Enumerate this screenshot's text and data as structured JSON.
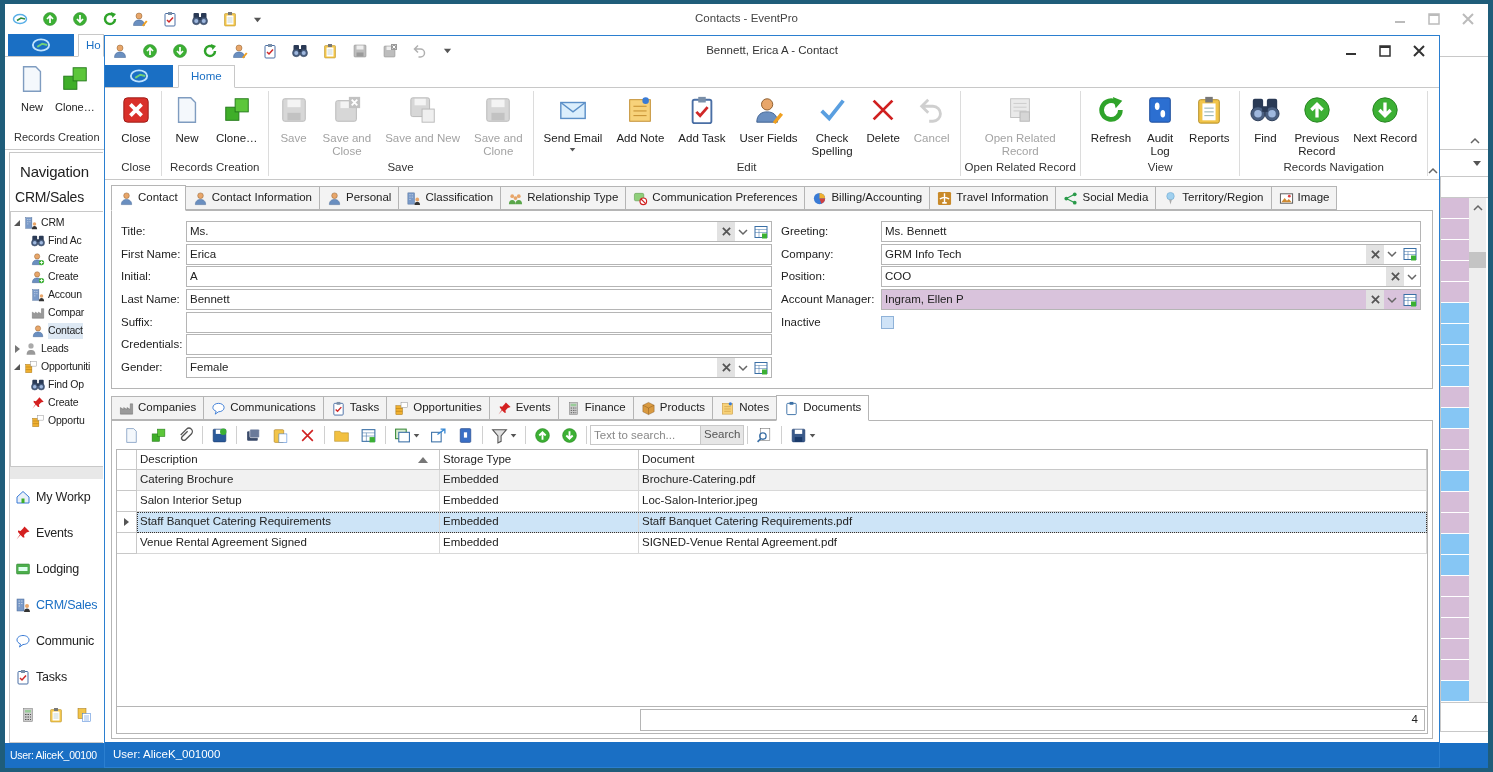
{
  "outer_window": {
    "title": "Contacts - EventPro",
    "ribbon_tabs": [
      {
        "label": "Ho",
        "selected": true
      }
    ],
    "ribbon_groups": [
      {
        "label": "Records Creation",
        "buttons": [
          {
            "label": "New",
            "disabled": false
          },
          {
            "label": "Clone…",
            "disabled": false
          }
        ]
      }
    ],
    "navigation": {
      "title": "Navigation",
      "section": "CRM/Sales",
      "tree": [
        {
          "label": "CRM",
          "expanded": true,
          "selected": false,
          "children": [
            {
              "label": "Find Ac",
              "selected": false
            },
            {
              "label": "Create",
              "selected": false
            },
            {
              "label": "Create",
              "selected": false
            },
            {
              "label": "Accoun",
              "selected": false
            },
            {
              "label": "Compar",
              "selected": false
            },
            {
              "label": "Contact",
              "selected": true
            }
          ]
        },
        {
          "label": "Leads",
          "expanded": false,
          "selected": false
        },
        {
          "label": "Opportuniti",
          "expanded": true,
          "selected": false,
          "children": [
            {
              "label": "Find Op",
              "selected": false
            },
            {
              "label": "Create",
              "selected": false
            },
            {
              "label": "Opportu",
              "selected": false
            }
          ]
        }
      ],
      "buttons": [
        {
          "label": "My Workp",
          "selected": false
        },
        {
          "label": "Events",
          "selected": false
        },
        {
          "label": "Lodging",
          "selected": false
        },
        {
          "label": "CRM/Sales",
          "selected": true
        },
        {
          "label": "Communic",
          "selected": false
        },
        {
          "label": "Tasks",
          "selected": false
        }
      ]
    },
    "grid_rows": [
      {
        "color": "#d6bdd8"
      },
      {
        "color": "#d6bdd8"
      },
      {
        "color": "#d6bdd8"
      },
      {
        "color": "#d6bdd8"
      },
      {
        "color": "#d6bdd8"
      },
      {
        "color": "#86c6f4"
      },
      {
        "color": "#86c6f4"
      },
      {
        "color": "#86c6f4"
      },
      {
        "color": "#86c6f4"
      },
      {
        "color": "#d6bdd8"
      },
      {
        "color": "#86c6f4"
      },
      {
        "color": "#d6bdd8"
      },
      {
        "color": "#d6bdd8"
      },
      {
        "color": "#86c6f4"
      },
      {
        "color": "#d6bdd8"
      },
      {
        "color": "#d6bdd8"
      },
      {
        "color": "#86c6f4"
      },
      {
        "color": "#86c6f4"
      },
      {
        "color": "#d6bdd8"
      },
      {
        "color": "#d6bdd8"
      },
      {
        "color": "#d6bdd8"
      },
      {
        "color": "#d6bdd8"
      },
      {
        "color": "#d6bdd8"
      },
      {
        "color": "#86c6f4"
      }
    ],
    "status_bar": "User: AliceK_00100"
  },
  "contact_window": {
    "title": "Bennett, Erica A - Contact",
    "ribbon_tabs": [
      {
        "label": "Home",
        "selected": true
      }
    ],
    "ribbon_groups": [
      {
        "label": "Close",
        "buttons": [
          {
            "label": "Close",
            "disabled": false
          }
        ]
      },
      {
        "label": "Records Creation",
        "buttons": [
          {
            "label": "New",
            "disabled": false
          },
          {
            "label": "Clone…",
            "disabled": false
          }
        ]
      },
      {
        "label": "Save",
        "buttons": [
          {
            "label": "Save",
            "disabled": true
          },
          {
            "label": "Save and\nClose",
            "disabled": true
          },
          {
            "label": "Save and New",
            "disabled": true
          },
          {
            "label": "Save and\nClone",
            "disabled": true
          }
        ]
      },
      {
        "label": "Edit",
        "buttons": [
          {
            "label": "Send Email",
            "disabled": false,
            "dropdown": true
          },
          {
            "label": "Add Note",
            "disabled": false
          },
          {
            "label": "Add Task",
            "disabled": false
          },
          {
            "label": "User Fields",
            "disabled": false
          },
          {
            "label": "Check\nSpelling",
            "disabled": false
          },
          {
            "label": "Delete",
            "disabled": false
          },
          {
            "label": "Cancel",
            "disabled": true
          }
        ]
      },
      {
        "label": "Open Related Record",
        "buttons": [
          {
            "label": "Open Related\nRecord",
            "disabled": true
          }
        ]
      },
      {
        "label": "View",
        "buttons": [
          {
            "label": "Refresh",
            "disabled": false
          },
          {
            "label": "Audit\nLog",
            "disabled": false
          },
          {
            "label": "Reports",
            "disabled": false
          }
        ]
      },
      {
        "label": "Records Navigation",
        "buttons": [
          {
            "label": "Find",
            "disabled": false
          },
          {
            "label": "Previous\nRecord",
            "disabled": false
          },
          {
            "label": "Next Record",
            "disabled": false
          }
        ]
      }
    ],
    "tabs": [
      {
        "label": "Contact",
        "selected": true
      },
      {
        "label": "Contact Information",
        "selected": false
      },
      {
        "label": "Personal",
        "selected": false
      },
      {
        "label": "Classification",
        "selected": false
      },
      {
        "label": "Relationship Type",
        "selected": false
      },
      {
        "label": "Communication Preferences",
        "selected": false
      },
      {
        "label": "Billing/Accounting",
        "selected": false
      },
      {
        "label": "Travel Information",
        "selected": false
      },
      {
        "label": "Social Media",
        "selected": false
      },
      {
        "label": "Territory/Region",
        "selected": false
      },
      {
        "label": "Image",
        "selected": false
      }
    ],
    "form": {
      "left": [
        {
          "label": "Title:",
          "kind": "lookup",
          "value": "Ms.",
          "highlighted": false
        },
        {
          "label": "First Name:",
          "kind": "text",
          "value": "Erica",
          "highlighted": false
        },
        {
          "label": "Initial:",
          "kind": "text",
          "value": "A",
          "highlighted": false
        },
        {
          "label": "Last Name:",
          "kind": "text",
          "value": "Bennett",
          "highlighted": false
        },
        {
          "label": "Suffix:",
          "kind": "text",
          "highlighted": false
        },
        {
          "label": "Credentials:",
          "kind": "text",
          "highlighted": false
        },
        {
          "label": "Gender:",
          "kind": "lookup",
          "value": "Female",
          "highlighted": false
        }
      ],
      "right": [
        {
          "label": "Greeting:",
          "kind": "text",
          "value": "Ms. Bennett",
          "highlighted": false
        },
        {
          "label": "Company:",
          "kind": "lookup",
          "value": "GRM Info Tech",
          "highlighted": false
        },
        {
          "label": "Position:",
          "kind": "combo",
          "value": "COO",
          "highlighted": false
        },
        {
          "label": "Account Manager:",
          "kind": "lookup",
          "value": "Ingram, Ellen P",
          "highlighted": true
        },
        {
          "label": "Inactive",
          "kind": "checkbox",
          "checked": false
        }
      ]
    },
    "detail_tabs": [
      {
        "label": "Companies",
        "selected": false
      },
      {
        "label": "Communications",
        "selected": false
      },
      {
        "label": "Tasks",
        "selected": false
      },
      {
        "label": "Opportunities",
        "selected": false
      },
      {
        "label": "Events",
        "selected": false
      },
      {
        "label": "Finance",
        "selected": false
      },
      {
        "label": "Products",
        "selected": false
      },
      {
        "label": "Notes",
        "selected": false
      },
      {
        "label": "Documents",
        "selected": true
      }
    ],
    "search": {
      "placeholder": "Text to search...",
      "button": "Search"
    },
    "documents": {
      "columns": [
        {
          "label": "Description",
          "sorted": true
        },
        {
          "label": "Storage Type",
          "sorted": false
        },
        {
          "label": "Document",
          "sorted": false
        }
      ],
      "rows": [
        {
          "cells": [
            "Catering Brochure",
            "Embedded",
            "Brochure-Catering.pdf"
          ],
          "selected": false
        },
        {
          "cells": [
            "Salon Interior Setup",
            "Embedded",
            "Loc-Salon-Interior.jpeg"
          ],
          "selected": false
        },
        {
          "cells": [
            "Staff Banquet Catering Requirements",
            "Embedded",
            "Staff Banquet Catering Requirements.pdf"
          ],
          "selected": true
        },
        {
          "cells": [
            "Venue Rental Agreement Signed",
            "Embedded",
            "SIGNED-Venue Rental Agreement.pdf"
          ],
          "selected": false
        }
      ],
      "count": "4"
    },
    "status_bar": "User: AliceK_001000"
  }
}
